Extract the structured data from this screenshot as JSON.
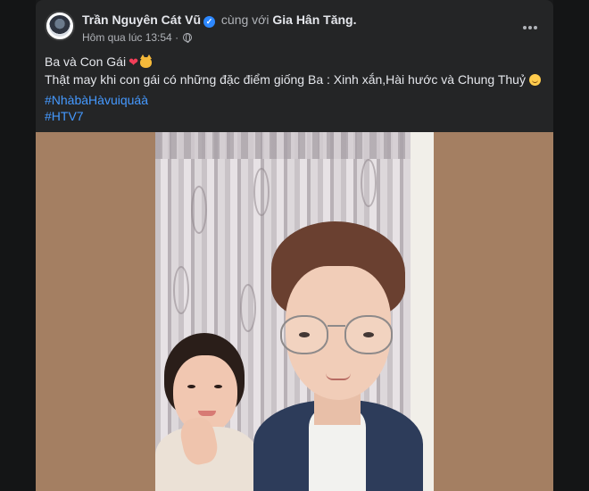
{
  "post": {
    "author": "Trần Nguyên Cát Vũ",
    "with_text": "cùng với",
    "tagged": "Gia Hân Tăng.",
    "timestamp": "Hôm qua lúc 13:54",
    "separator": "·",
    "caption_line1": "Ba và Con Gái",
    "caption_line2": "Thật may khi con gái có những đặc điểm giống Ba : Xinh xắn,Hài hước và Chung Thuỷ",
    "hashtags": [
      "#NhàbàHàvuiquáà",
      "#HTV7"
    ]
  },
  "icons": {
    "verified": "verified-badge-icon",
    "privacy": "globe-icon",
    "menu": "more-options-icon",
    "emoji1": "red-heart-icon",
    "emoji2": "cat-face-icon",
    "emoji3": "smiling-face-icon"
  },
  "colors": {
    "background": "#18191a",
    "card": "#242526",
    "hashtag": "#4599ff",
    "verified": "#2d88ff",
    "photo_frame": "#a47f62"
  }
}
